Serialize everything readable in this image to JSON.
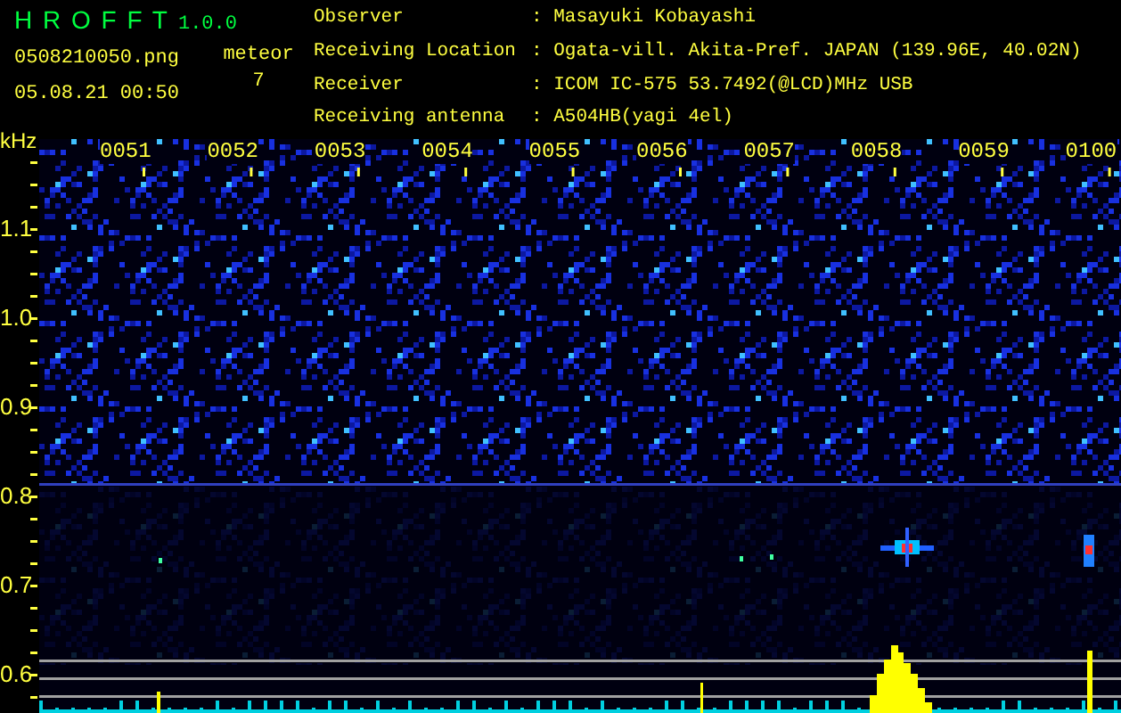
{
  "app": {
    "name": "H R O F F T",
    "version": "1.0.0",
    "filename": "0508210050.png",
    "datetime": "05.08.21 00:50"
  },
  "meteor": {
    "label": "meteor",
    "count": "7"
  },
  "info": [
    {
      "label": "Observer",
      "value": ": Masayuki Kobayashi"
    },
    {
      "label": "Receiving Location",
      "value": ": Ogata-vill. Akita-Pref. JAPAN (139.96E, 40.02N)"
    },
    {
      "label": "Receiver",
      "value": ": ICOM IC-575 53.7492(@LCD)MHz USB"
    },
    {
      "label": "Receiving antenna",
      "value": ": A504HB(yagi 4el)"
    }
  ],
  "spectrogram": {
    "unit": "kHz",
    "frequency_labels": [
      "1.1",
      "1.0",
      "0.9",
      "0.8",
      "0.7",
      "0.6"
    ],
    "time_labels": [
      "0051",
      "0052",
      "0053",
      "0054",
      "0055",
      "0056",
      "0057",
      "0058",
      "0059",
      "0100"
    ]
  }
}
